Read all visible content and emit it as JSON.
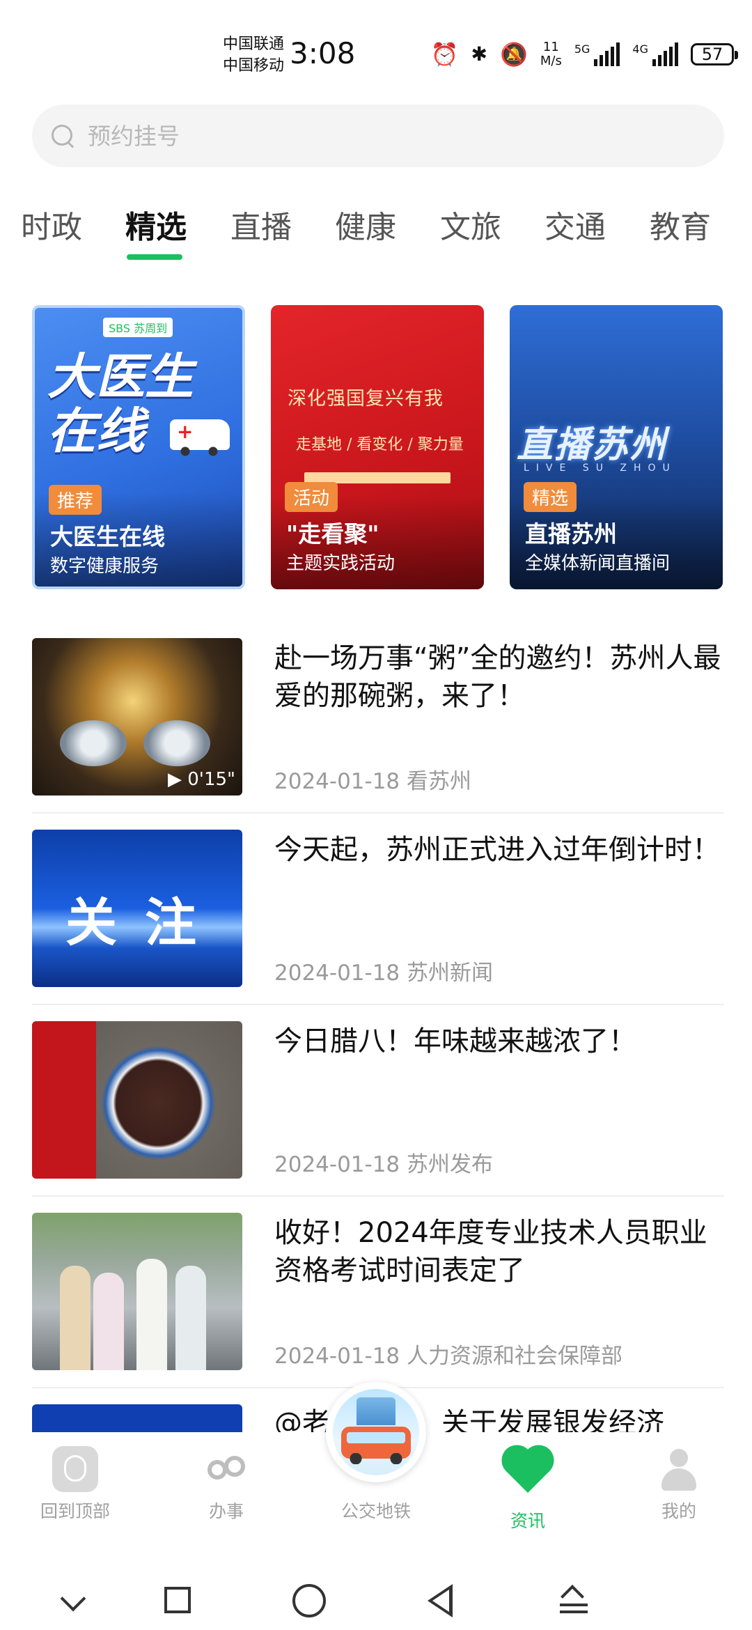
{
  "status_bar": {
    "carrier1": "中国联通",
    "carrier2": "中国移动",
    "time": "3:08",
    "speed_value": "11",
    "speed_unit": "M/s",
    "net1": "5G",
    "net2": "4G",
    "battery": "57",
    "icons": [
      "alarm-icon",
      "bluetooth-icon",
      "mute-icon",
      "signal-icon",
      "battery-icon"
    ]
  },
  "search": {
    "placeholder": "预约挂号"
  },
  "tabs": [
    "时政",
    "精选",
    "直播",
    "健康",
    "文旅",
    "交通",
    "教育"
  ],
  "active_tab": "精选",
  "banners": [
    {
      "art_title": "大医生在线",
      "logo_text": "SBS 苏周到",
      "tag": "推荐",
      "title": "大医生在线",
      "subtitle": "数字健康服务"
    },
    {
      "art_line1": "深化强国复兴有我",
      "art_line2": "走基地 / 看变化 / 聚力量",
      "tag": "活动",
      "title": "\"走看聚\"",
      "subtitle": "主题实践活动"
    },
    {
      "art_line1": "直播苏州",
      "art_line2": "LIVE SU ZHOU",
      "tag": "精选",
      "title": "直播苏州",
      "subtitle": "全媒体新闻直播间"
    }
  ],
  "news": [
    {
      "title": "赴一场万事“粥”全的邀约！苏州人最爱的那碗粥，来了！",
      "date": "2024-01-18",
      "source": "看苏州",
      "duration": "▶ 0'15\""
    },
    {
      "title": "今天起，苏州正式进入过年倒计时！",
      "date": "2024-01-18",
      "source": "苏州新闻",
      "thumb_text": "关注"
    },
    {
      "title": "今日腊八！年味越来越浓了！",
      "date": "2024-01-18",
      "source": "苏州发布"
    },
    {
      "title": "收好！2024年度专业技术人员职业资格考试时间表定了",
      "date": "2024-01-18",
      "source": "人力资源和社会保障部"
    },
    {
      "title": "@老年朋友：关于发展银发经济"
    }
  ],
  "bottom_nav": [
    {
      "label": "回到顶部",
      "icon": "back-to-top-icon"
    },
    {
      "label": "办事",
      "icon": "services-icon"
    },
    {
      "label": "公交地铁",
      "icon": "bus-icon"
    },
    {
      "label": "资讯",
      "icon": "heart-icon"
    },
    {
      "label": "我的",
      "icon": "user-icon"
    }
  ],
  "colors": {
    "accent": "#1bbf60",
    "tag": "#f08c3c",
    "meta": "#9a9a9a"
  }
}
